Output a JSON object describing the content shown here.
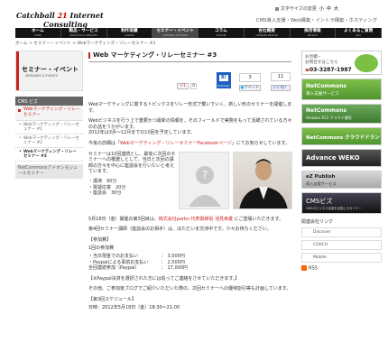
{
  "header": {
    "logo_line1_a": "Catchball",
    "logo_line1_b": " 21 ",
    "logo_line1_c": "Internet",
    "logo_line2": "Consulting",
    "font_size_label": "文字サイズの変更",
    "font_small": "小",
    "font_medium": "中",
    "font_large": "大",
    "tagline": "CMS導入支援・Web構築・イントラ構築・ホスティング"
  },
  "nav": [
    {
      "jp": "ホーム",
      "en": "HOME"
    },
    {
      "jp": "製品・サービス",
      "en": "PRODUCTS & SERVICES"
    },
    {
      "jp": "制作実績",
      "en": "CLIENTS"
    },
    {
      "jp": "セミナー・イベント",
      "en": "SEMINARS & EVENTS"
    },
    {
      "jp": "コラム",
      "en": "COLUMN"
    },
    {
      "jp": "会社概要",
      "en": "COMPANY PROFILE"
    },
    {
      "jp": "採用情報",
      "en": "RECRUIT"
    },
    {
      "jp": "よくあるご質問",
      "en": "Q&A"
    }
  ],
  "breadcrumb": "ホーム > セミナー・イベント > Webマーケティング・リレーセミナー #3",
  "sidebar": {
    "banner_title": "セミナー・イベント",
    "banner_sub": "SEMINARS & EVENTS",
    "menu_header": "CMS ビズ",
    "selected": "Webマーケティング・リレーセミナー",
    "subs": [
      "Webマーケティング・リレーセミナー #1",
      "Webマーケティング・リレーセミナー #2",
      "Webマーケティング・リレーセミナー #3"
    ],
    "other": "NetCommonsアドオンモジュールセミナー"
  },
  "page_title": "Web マーケティング・リレーセミナー #3",
  "social": {
    "g_count": "+1",
    "g_num": "0",
    "bookmark_num": "3",
    "tweet": "ツイート",
    "fb_label": "いいね！",
    "fb_count": "11",
    "bookmark_label": "Bookmark"
  },
  "content": {
    "p1": "Webマーケティングに関するトピックスをリレー形式で繋いでいく、新しい形のセミナーを開催します。",
    "p2": "Webビジネスを行う上で重要かつ最新の情報を、そのフィールドで実務をもって活躍されている方々のお話をうかがいます。",
    "p3": "2012年は3月〜12月までの10回を予定しています。",
    "p4a": "今後の詳細は「",
    "p4link": "Webマーケティング・リレーセミナーFacebookページ",
    "p4b": "」にてお知らせしています。",
    "p5": "セミナーは10回連続とし、最後に次回のセミナーへの橋渡しとして、当日と次回の講師の方々を中心に座談会を行いたいと考えています。",
    "lines": [
      "・講演　90分",
      "・質疑応答　20分",
      "・座談会　30分"
    ],
    "p6a": "5月18日（金）開催の第3回目は、",
    "p6link": "株式会社parbs 代表取締役 池見幸雄",
    "p6b": " にご登壇いただきます。",
    "p7": "第4回セミナー講師（座談会のお相手）は、ほただいま交渉中です。少々お待ちください。",
    "fee_head": "【参加費】",
    "fee_sub": "1回の参加費",
    "fees": [
      [
        "・当日現金でのお支払い",
        "：　3,000円"
      ],
      [
        "・Paypalによる事前お支払い",
        "：　2,500円"
      ],
      [
        "全回連続参加（Paypal）",
        "：　17,000円"
      ]
    ],
    "p8": "【※Paypal決済を選択された方には追ってご連絡をさせていただきます。】",
    "p9": "その他、ご参加後ブログでご紹介いただいた際の、次回セミナーへの優待割引等も計画しています。",
    "sched_head": "【第3回スケジュール】",
    "sched": "日時：2012年5月18日（金）18:30〜21:00"
  },
  "right": {
    "form_title": "お見積・",
    "form_sub": "お問合せはこちら",
    "phone": "03-3287-1987",
    "green1_title": "NetCommons",
    "green1_sub": "導入支援サービス",
    "green2_title": "NetCommons",
    "green2_sub": "Amazon EC2 クラウド運用",
    "green3_title": "NetCommons クラウドドラン",
    "advance": "Advance WEKO",
    "ez_title": "eZ Publish",
    "ez_sub": "導入支援サービス",
    "cms_title": "CMSビズ",
    "cms_sub": "CMSのビジネス活用を目指したセミナー",
    "related": "関連会社リンク",
    "links": [
      "Discover",
      "COACH",
      "Mobile"
    ],
    "rss": "RSS"
  },
  "colors": {
    "accent": "#cc2222",
    "nav": "#141414",
    "green": "#5aa53a"
  }
}
